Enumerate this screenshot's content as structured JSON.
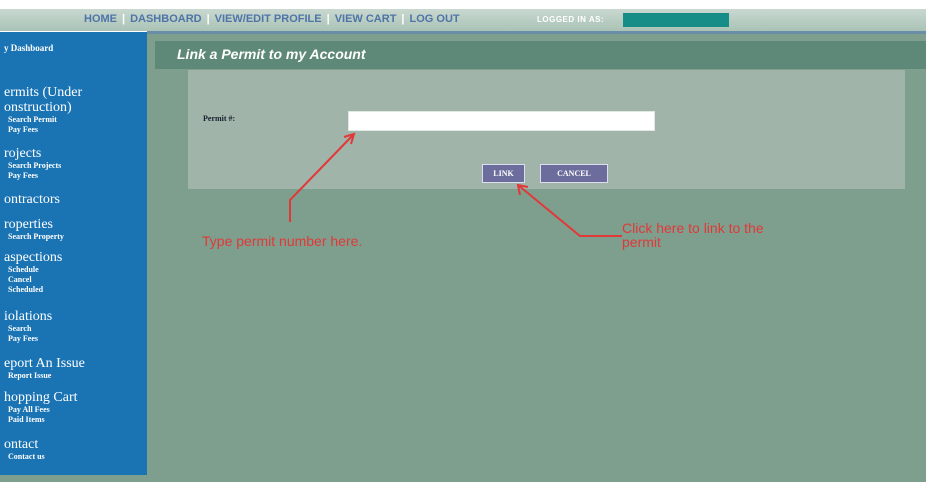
{
  "nav": {
    "links": [
      "HOME",
      "DASHBOARD",
      "VIEW/EDIT PROFILE",
      "VIEW CART",
      "LOG OUT"
    ],
    "logged_in_label": "LOGGED IN AS:"
  },
  "sidebar": {
    "dashboard": "y Dashboard",
    "groups": [
      {
        "title": "ermits (Under onstruction)",
        "items": [
          "Search Permit",
          "Pay Fees"
        ]
      },
      {
        "title": "rojects",
        "items": [
          "Search Projects",
          "Pay Fees"
        ]
      },
      {
        "title": "ontractors",
        "items": []
      },
      {
        "title": "roperties",
        "items": [
          "Search Property"
        ]
      },
      {
        "title": "aspections",
        "items": [
          "Schedule",
          "Cancel",
          "Scheduled"
        ]
      },
      {
        "title": "iolations",
        "items": [
          "Search",
          "Pay Fees"
        ]
      },
      {
        "title": "eport An Issue",
        "items": [
          "Report Issue"
        ]
      },
      {
        "title": "hopping Cart",
        "items": [
          "Pay All Fees",
          "Paid Items"
        ]
      },
      {
        "title": "ontact",
        "items": [
          "Contact us"
        ]
      }
    ]
  },
  "main": {
    "title": "Link a Permit to my Account",
    "permit_label": "Permit #:",
    "permit_value": "",
    "link_button": "LINK",
    "cancel_button": "CANCEL"
  },
  "annotations": {
    "left": "Type permit number here.",
    "right": "Click here to link to the permit"
  },
  "colors": {
    "sidebar": "#1a74b4",
    "background": "#7e9f8e",
    "button": "#6c6d9d",
    "annotation": "#e13838"
  }
}
